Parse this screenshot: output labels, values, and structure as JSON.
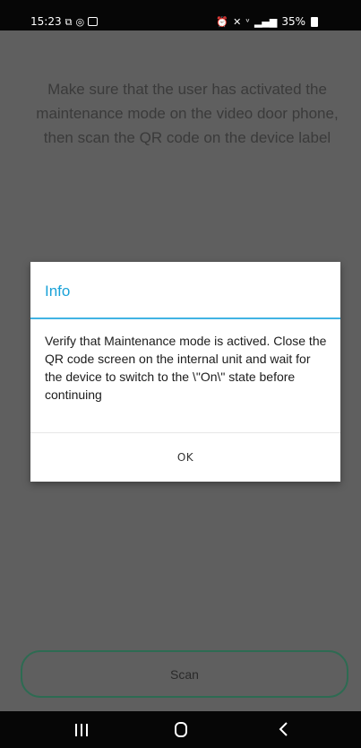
{
  "status_bar": {
    "time": "15:23",
    "battery": "35%",
    "left_icons": [
      "notification-icon",
      "whatsapp-icon",
      "gallery-icon"
    ],
    "right_icons": [
      "alarm-icon",
      "mute-icon",
      "volte-icon",
      "signal-icon",
      "battery-icon"
    ]
  },
  "main": {
    "instruction": "Make sure that the user has activated the maintenance mode on the video door phone, then scan the QR code on the device label"
  },
  "dialog": {
    "title": "Info",
    "message": "Verify that Maintenance mode is actived. Close the QR code screen on the internal unit and wait for the device to switch to the \\\"On\\\" state before continuing",
    "ok_label": "OK"
  },
  "scan_button": {
    "label": "Scan"
  },
  "nav_bar": {
    "icons": [
      "recents-icon",
      "home-icon",
      "back-icon"
    ]
  },
  "colors": {
    "accent": "#1aa2d8",
    "scan_border": "#2d6b52",
    "overlay": "#5f5f5f"
  }
}
